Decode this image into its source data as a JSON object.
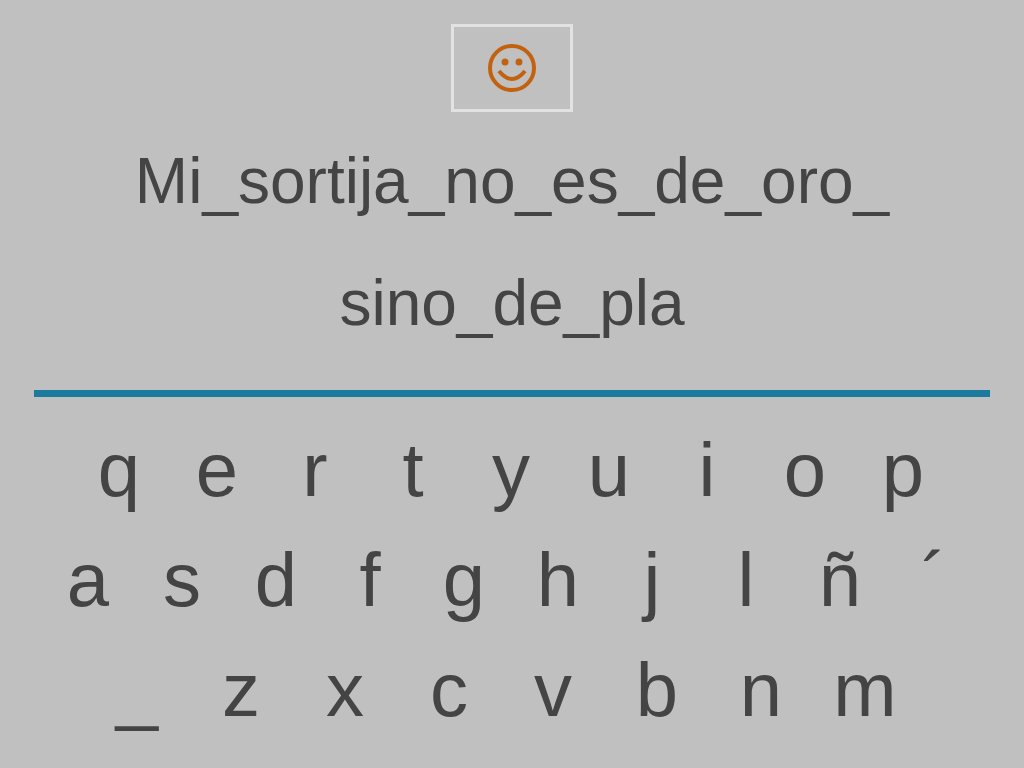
{
  "sentence_lines": [
    "Mi_sortija_no_es_de_oro_",
    "sino_de_pla"
  ],
  "keyboard_rows": [
    {
      "keys": [
        "q",
        "e",
        "r",
        "t",
        "y",
        "u",
        "i",
        "o",
        "p"
      ]
    },
    {
      "keys": [
        "a",
        "s",
        "d",
        "f",
        "g",
        "h",
        "j",
        "l",
        "ñ",
        "´"
      ]
    },
    {
      "keys": [
        "_",
        "z",
        "x",
        "c",
        "v",
        "b",
        "n",
        "m"
      ]
    }
  ]
}
